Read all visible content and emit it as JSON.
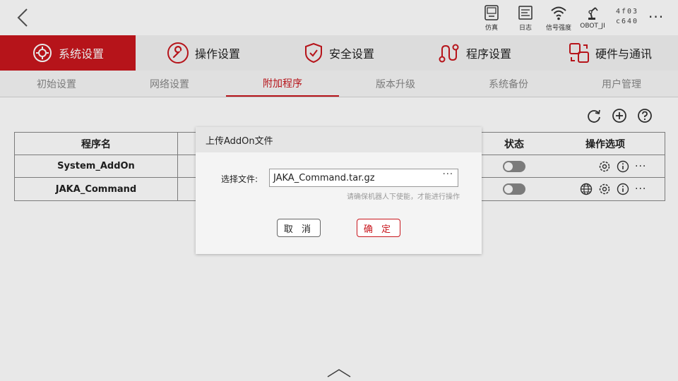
{
  "topbar": {
    "status_items": [
      {
        "name": "simulation",
        "label": "仿真",
        "icon": "monitor-icon"
      },
      {
        "name": "log",
        "label": "日志",
        "icon": "log-icon"
      },
      {
        "name": "signal",
        "label": "信号强度",
        "icon": "wifi-icon"
      },
      {
        "name": "robot",
        "label": "OBOT_JI",
        "icon": "robot-arm-icon"
      }
    ],
    "serial_line1": "4f03",
    "serial_line2": "c640",
    "more": "···"
  },
  "main_nav": [
    {
      "label": "系统设置",
      "icon": "system-settings-icon",
      "active": true
    },
    {
      "label": "操作设置",
      "icon": "wrench-icon",
      "active": false
    },
    {
      "label": "安全设置",
      "icon": "shield-icon",
      "active": false
    },
    {
      "label": "程序设置",
      "icon": "program-icon",
      "active": false
    },
    {
      "label": "硬件与通讯",
      "icon": "hardware-icon",
      "active": false
    }
  ],
  "sub_nav": [
    {
      "label": "初始设置",
      "active": false
    },
    {
      "label": "网络设置",
      "active": false
    },
    {
      "label": "附加程序",
      "active": true
    },
    {
      "label": "版本升级",
      "active": false
    },
    {
      "label": "系统备份",
      "active": false
    },
    {
      "label": "用户管理",
      "active": false
    }
  ],
  "table": {
    "headers": {
      "name": "程序名",
      "status": "状态",
      "ops": "操作选项"
    },
    "rows": [
      {
        "name": "System_AddOn",
        "enabled": false,
        "has_web": false
      },
      {
        "name": "JAKA_Command",
        "enabled": false,
        "has_web": true
      }
    ]
  },
  "dialog": {
    "title": "上传AddOn文件",
    "file_label": "选择文件:",
    "file_value": "JAKA_Command.tar.gz",
    "browse": "···",
    "hint": "请确保机器人下使能，才能进行操作",
    "cancel": "取 消",
    "ok": "确 定"
  },
  "colors": {
    "accent": "#c8161d"
  }
}
